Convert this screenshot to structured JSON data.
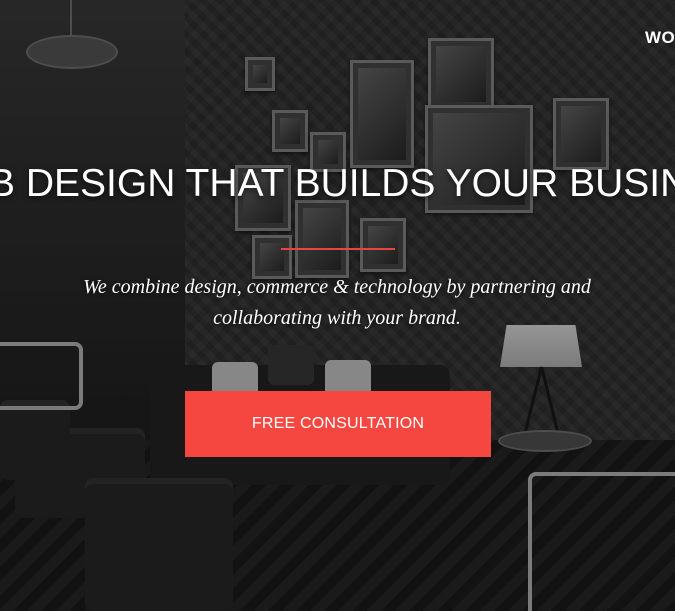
{
  "nav": {
    "link_label": "WO"
  },
  "hero": {
    "headline": "B DESIGN THAT BUILDS YOUR BUSIN",
    "subtext": "We combine design, commerce & technology by partnering and collaborating with your brand.",
    "cta_label": "FREE CONSULTATION"
  },
  "colors": {
    "accent": "#f5473f",
    "divider": "#e8453c",
    "text": "#ffffff"
  }
}
